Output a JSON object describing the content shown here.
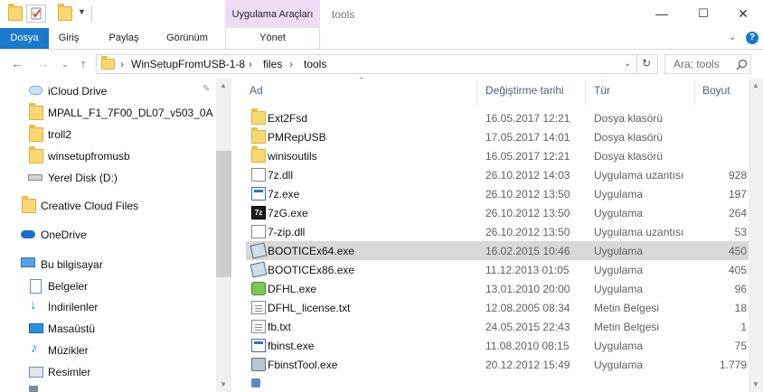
{
  "window": {
    "title": "tools",
    "tool_tab": "Uygulama Araçları",
    "controls": {
      "minimize": "—",
      "maximize": "☐",
      "close": "✕"
    }
  },
  "ribbon": {
    "tabs": [
      "Dosya",
      "Giriş",
      "Paylaş",
      "Görünüm",
      "Yönet"
    ],
    "expand_icon": "chevron-down-icon",
    "help_icon": "help-icon"
  },
  "address": {
    "crumbs": [
      "WinSetupFromUSB-1-8",
      "files",
      "tools"
    ],
    "search_placeholder": "Ara: tools"
  },
  "nav": {
    "items": [
      {
        "label": "iCloud Drive",
        "icon": "icloud-icon"
      },
      {
        "label": "MPALL_F1_7F00_DL07_v503_0A",
        "icon": "folder-icon"
      },
      {
        "label": "troll2",
        "icon": "folder-icon"
      },
      {
        "label": "winsetupfromusb",
        "icon": "folder-icon"
      },
      {
        "label": "Yerel Disk (D:)",
        "icon": "drive-icon"
      },
      {
        "label": "Creative Cloud Files",
        "icon": "creative-cloud-icon"
      },
      {
        "label": "OneDrive",
        "icon": "onedrive-icon"
      },
      {
        "label": "Bu bilgisayar",
        "icon": "computer-icon"
      },
      {
        "label": "Belgeler",
        "icon": "documents-icon"
      },
      {
        "label": "İndirilenler",
        "icon": "downloads-icon"
      },
      {
        "label": "Masaüstü",
        "icon": "desktop-icon"
      },
      {
        "label": "Müzikler",
        "icon": "music-icon"
      },
      {
        "label": "Resimler",
        "icon": "pictures-icon"
      }
    ]
  },
  "list": {
    "columns": [
      "Ad",
      "Değiştirme tarihi",
      "Tür",
      "Boyut"
    ],
    "rows": [
      {
        "name": "Ext2Fsd",
        "date": "16.05.2017 12:21",
        "type": "Dosya klasörü",
        "size": "",
        "icon": "folder-icon"
      },
      {
        "name": "PMRepUSB",
        "date": "17.05.2017 14:01",
        "type": "Dosya klasörü",
        "size": "",
        "icon": "folder-icon"
      },
      {
        "name": "winisoutils",
        "date": "16.05.2017 12:21",
        "type": "Dosya klasörü",
        "size": "",
        "icon": "folder-icon"
      },
      {
        "name": "7z.dll",
        "date": "26.10.2012 14:03",
        "type": "Uygulama uzantısı",
        "size": "928",
        "icon": "dll-icon"
      },
      {
        "name": "7z.exe",
        "date": "26.10.2012 13:50",
        "type": "Uygulama",
        "size": "197",
        "icon": "exe-icon"
      },
      {
        "name": "7zG.exe",
        "date": "26.10.2012 13:50",
        "type": "Uygulama",
        "size": "264",
        "icon": "7zip-icon"
      },
      {
        "name": "7-zip.dll",
        "date": "26.10.2012 13:50",
        "type": "Uygulama uzantısı",
        "size": "53",
        "icon": "dll-icon"
      },
      {
        "name": "BOOTICEx64.exe",
        "date": "16.02.2015 10:46",
        "type": "Uygulama",
        "size": "450",
        "icon": "bootice-icon"
      },
      {
        "name": "BOOTICEx86.exe",
        "date": "11.12.2013 01:05",
        "type": "Uygulama",
        "size": "405",
        "icon": "bootice-icon"
      },
      {
        "name": "DFHL.exe",
        "date": "13.01.2010 20:00",
        "type": "Uygulama",
        "size": "96",
        "icon": "dfhl-icon"
      },
      {
        "name": "DFHL_license.txt",
        "date": "12.08.2005 08:34",
        "type": "Metin Belgesi",
        "size": "18",
        "icon": "text-file-icon"
      },
      {
        "name": "fb.txt",
        "date": "24.05.2015 22:43",
        "type": "Metin Belgesi",
        "size": "1",
        "icon": "text-file-icon"
      },
      {
        "name": "fbinst.exe",
        "date": "11.08.2010 08:15",
        "type": "Uygulama",
        "size": "75",
        "icon": "exe-icon"
      },
      {
        "name": "FbinstTool.exe",
        "date": "20.12.2012 15:49",
        "type": "Uygulama",
        "size": "1.779",
        "icon": "tool-icon"
      }
    ]
  },
  "colors": {
    "accent": "#1979ca",
    "tool_tab_bg": "#eedcf5",
    "selection": "#d9d9d9",
    "folder": "#f8d775"
  }
}
